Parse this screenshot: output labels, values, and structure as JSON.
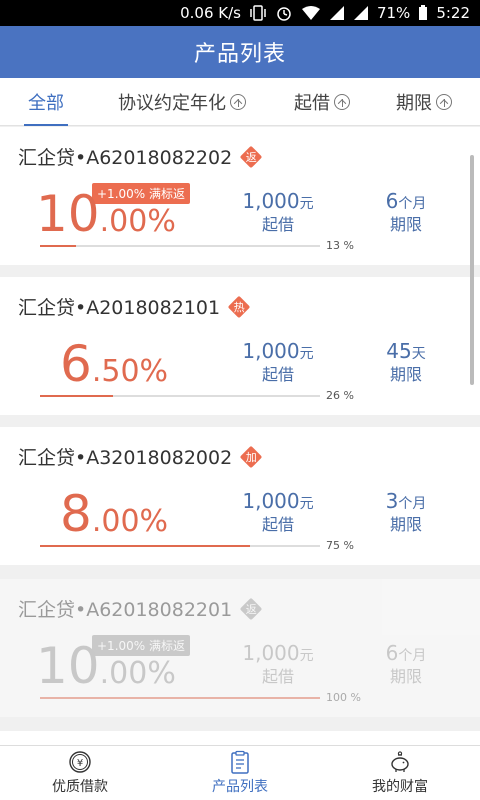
{
  "status": {
    "speed": "0.06 K/s",
    "battery": "71%",
    "time": "5:22"
  },
  "header": {
    "title": "产品列表"
  },
  "filters": [
    {
      "label": "全部"
    },
    {
      "label": "协议约定年化"
    },
    {
      "label": "起借"
    },
    {
      "label": "期限"
    }
  ],
  "products": [
    {
      "name": "汇企贷•A62018082202",
      "tag": "返",
      "tag_color": "#ec6d50",
      "rate_int": "10",
      "rate_dec": "00%",
      "bonus": "+1.00% 满标返",
      "amount": "1,000",
      "amount_unit": "元",
      "amount_label": "起借",
      "term": "6",
      "term_unit": "个月",
      "term_label": "期限",
      "progress": 13,
      "progress_text": "13 %"
    },
    {
      "name": "汇企贷•A2018082101",
      "tag": "热",
      "tag_color": "#ec6d50",
      "rate_int": "6",
      "rate_dec": "50%",
      "bonus": "",
      "amount": "1,000",
      "amount_unit": "元",
      "amount_label": "起借",
      "term": "45",
      "term_unit": "天",
      "term_label": "期限",
      "progress": 26,
      "progress_text": "26 %"
    },
    {
      "name": "汇企贷•A32018082002",
      "tag": "加",
      "tag_color": "#ec6d50",
      "rate_int": "8",
      "rate_dec": "00%",
      "bonus": "",
      "amount": "1,000",
      "amount_unit": "元",
      "amount_label": "起借",
      "term": "3",
      "term_unit": "个月",
      "term_label": "期限",
      "progress": 75,
      "progress_text": "75 %"
    },
    {
      "name": "汇企贷•A62018082201",
      "tag": "返",
      "tag_color": "#9a9a9a",
      "rate_int": "10",
      "rate_dec": "00%",
      "bonus": "+1.00% 满标返",
      "amount": "1,000",
      "amount_unit": "元",
      "amount_label": "起借",
      "term": "6",
      "term_unit": "个月",
      "term_label": "期限",
      "progress": 100,
      "progress_text": "100 %"
    }
  ],
  "bottom_nav": [
    {
      "label": "优质借款",
      "icon": "yuan-coin-icon"
    },
    {
      "label": "产品列表",
      "icon": "clipboard-icon"
    },
    {
      "label": "我的财富",
      "icon": "piggy-bank-icon"
    }
  ],
  "colors": {
    "accent": "#4a73c1",
    "rate": "#e06a4f",
    "amount": "#4a6ea8"
  }
}
